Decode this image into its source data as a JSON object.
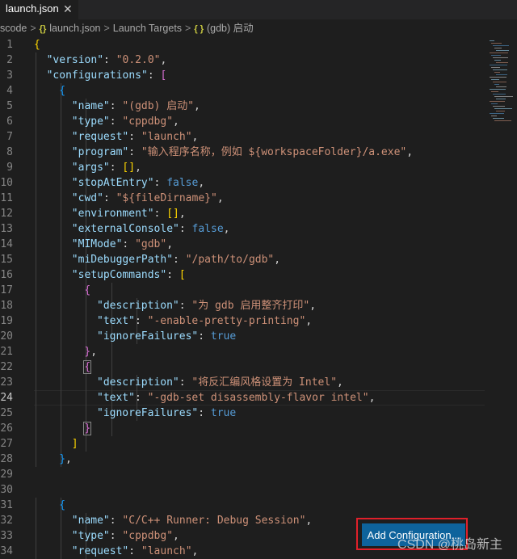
{
  "tab": {
    "title": "launch.json",
    "close": "✕"
  },
  "breadcrumb": {
    "items": [
      {
        "name": "bc-folder",
        "text": "scode"
      },
      {
        "name": "bc-file",
        "text": "launch.json",
        "icon": "{}"
      },
      {
        "name": "bc-section",
        "text": "Launch Targets"
      },
      {
        "name": "bc-symbol",
        "text": "(gdb) 启动",
        "icon": "{ }"
      }
    ],
    "separator": ">"
  },
  "current_line": 24,
  "code_lines": [
    {
      "n": 1,
      "indent": 0,
      "t": [
        [
          "b1",
          "{"
        ]
      ]
    },
    {
      "n": 2,
      "indent": 1,
      "t": [
        [
          "key",
          "\"version\""
        ],
        [
          "p",
          ": "
        ],
        [
          "str",
          "\"0.2.0\""
        ],
        [
          "p",
          ","
        ]
      ]
    },
    {
      "n": 3,
      "indent": 1,
      "t": [
        [
          "key",
          "\"configurations\""
        ],
        [
          "p",
          ": "
        ],
        [
          "b2",
          "["
        ]
      ]
    },
    {
      "n": 4,
      "indent": 2,
      "t": [
        [
          "b3",
          "{"
        ]
      ]
    },
    {
      "n": 5,
      "indent": 3,
      "t": [
        [
          "key",
          "\"name\""
        ],
        [
          "p",
          ": "
        ],
        [
          "str",
          "\"(gdb) 启动\""
        ],
        [
          "p",
          ","
        ]
      ]
    },
    {
      "n": 6,
      "indent": 3,
      "t": [
        [
          "key",
          "\"type\""
        ],
        [
          "p",
          ": "
        ],
        [
          "str",
          "\"cppdbg\""
        ],
        [
          "p",
          ","
        ]
      ]
    },
    {
      "n": 7,
      "indent": 3,
      "t": [
        [
          "key",
          "\"request\""
        ],
        [
          "p",
          ": "
        ],
        [
          "str",
          "\"launch\""
        ],
        [
          "p",
          ","
        ]
      ]
    },
    {
      "n": 8,
      "indent": 3,
      "t": [
        [
          "key",
          "\"program\""
        ],
        [
          "p",
          ": "
        ],
        [
          "str",
          "\"输入程序名称，例如 ${workspaceFolder}/a.exe\""
        ],
        [
          "p",
          ","
        ]
      ]
    },
    {
      "n": 9,
      "indent": 3,
      "t": [
        [
          "key",
          "\"args\""
        ],
        [
          "p",
          ": "
        ],
        [
          "b1",
          "[]"
        ],
        [
          "p",
          ","
        ]
      ]
    },
    {
      "n": 10,
      "indent": 3,
      "t": [
        [
          "key",
          "\"stopAtEntry\""
        ],
        [
          "p",
          ": "
        ],
        [
          "kw",
          "false"
        ],
        [
          "p",
          ","
        ]
      ]
    },
    {
      "n": 11,
      "indent": 3,
      "t": [
        [
          "key",
          "\"cwd\""
        ],
        [
          "p",
          ": "
        ],
        [
          "str",
          "\"${fileDirname}\""
        ],
        [
          "p",
          ","
        ]
      ]
    },
    {
      "n": 12,
      "indent": 3,
      "t": [
        [
          "key",
          "\"environment\""
        ],
        [
          "p",
          ": "
        ],
        [
          "b1",
          "[]"
        ],
        [
          "p",
          ","
        ]
      ]
    },
    {
      "n": 13,
      "indent": 3,
      "t": [
        [
          "key",
          "\"externalConsole\""
        ],
        [
          "p",
          ": "
        ],
        [
          "kw",
          "false"
        ],
        [
          "p",
          ","
        ]
      ]
    },
    {
      "n": 14,
      "indent": 3,
      "t": [
        [
          "key",
          "\"MIMode\""
        ],
        [
          "p",
          ": "
        ],
        [
          "str",
          "\"gdb\""
        ],
        [
          "p",
          ","
        ]
      ]
    },
    {
      "n": 15,
      "indent": 3,
      "t": [
        [
          "key",
          "\"miDebuggerPath\""
        ],
        [
          "p",
          ": "
        ],
        [
          "str",
          "\"/path/to/gdb\""
        ],
        [
          "p",
          ","
        ]
      ]
    },
    {
      "n": 16,
      "indent": 3,
      "t": [
        [
          "key",
          "\"setupCommands\""
        ],
        [
          "p",
          ": "
        ],
        [
          "b1",
          "["
        ]
      ]
    },
    {
      "n": 17,
      "indent": 4,
      "t": [
        [
          "b2",
          "{"
        ]
      ]
    },
    {
      "n": 18,
      "indent": 5,
      "t": [
        [
          "key",
          "\"description\""
        ],
        [
          "p",
          ": "
        ],
        [
          "str",
          "\"为 gdb 启用整齐打印\""
        ],
        [
          "p",
          ","
        ]
      ]
    },
    {
      "n": 19,
      "indent": 5,
      "t": [
        [
          "key",
          "\"text\""
        ],
        [
          "p",
          ": "
        ],
        [
          "str",
          "\"-enable-pretty-printing\""
        ],
        [
          "p",
          ","
        ]
      ]
    },
    {
      "n": 20,
      "indent": 5,
      "t": [
        [
          "key",
          "\"ignoreFailures\""
        ],
        [
          "p",
          ": "
        ],
        [
          "kw",
          "true"
        ]
      ]
    },
    {
      "n": 21,
      "indent": 4,
      "t": [
        [
          "b2",
          "}"
        ],
        [
          "p",
          ","
        ]
      ]
    },
    {
      "n": 22,
      "indent": 4,
      "t": [
        [
          "b2m",
          "{"
        ]
      ]
    },
    {
      "n": 23,
      "indent": 5,
      "t": [
        [
          "key",
          "\"description\""
        ],
        [
          "p",
          ": "
        ],
        [
          "str",
          "\"将反汇编风格设置为 Intel\""
        ],
        [
          "p",
          ","
        ]
      ]
    },
    {
      "n": 24,
      "indent": 5,
      "t": [
        [
          "key",
          "\"text\""
        ],
        [
          "p",
          ": "
        ],
        [
          "str",
          "\"-gdb-set disassembly-flavor intel\""
        ],
        [
          "p",
          ","
        ]
      ]
    },
    {
      "n": 25,
      "indent": 5,
      "t": [
        [
          "key",
          "\"ignoreFailures\""
        ],
        [
          "p",
          ": "
        ],
        [
          "kw",
          "true"
        ]
      ]
    },
    {
      "n": 26,
      "indent": 4,
      "t": [
        [
          "b2m",
          "}"
        ]
      ]
    },
    {
      "n": 27,
      "indent": 3,
      "t": [
        [
          "b1",
          "]"
        ]
      ]
    },
    {
      "n": 28,
      "indent": 2,
      "t": [
        [
          "b3",
          "}"
        ],
        [
          "p",
          ","
        ]
      ]
    },
    {
      "n": 29,
      "indent": 0,
      "t": []
    },
    {
      "n": 30,
      "indent": 0,
      "t": []
    },
    {
      "n": 31,
      "indent": 2,
      "t": [
        [
          "b3",
          "{"
        ]
      ]
    },
    {
      "n": 32,
      "indent": 3,
      "t": [
        [
          "key",
          "\"name\""
        ],
        [
          "p",
          ": "
        ],
        [
          "str",
          "\"C/C++ Runner: Debug Session\""
        ],
        [
          "p",
          ","
        ]
      ]
    },
    {
      "n": 33,
      "indent": 3,
      "t": [
        [
          "key",
          "\"type\""
        ],
        [
          "p",
          ": "
        ],
        [
          "str",
          "\"cppdbg\""
        ],
        [
          "p",
          ","
        ]
      ]
    },
    {
      "n": 34,
      "indent": 3,
      "t": [
        [
          "key",
          "\"request\""
        ],
        [
          "p",
          ": "
        ],
        [
          "str",
          "\"launch\""
        ],
        [
          "p",
          ","
        ]
      ]
    }
  ],
  "add_configuration": {
    "label": "Add Configuration..."
  },
  "watermark": {
    "text": "CSDN @桃岛新主"
  },
  "colors": {
    "editor_bg": "#1e1e1e",
    "key": "#9cdcfe",
    "string": "#ce9178",
    "keyword": "#569cd6",
    "bracket_1": "#ffd700",
    "bracket_2": "#da70d6",
    "bracket_3": "#179fff",
    "button": "#0e639c",
    "highlight_box": "#e0202a"
  }
}
